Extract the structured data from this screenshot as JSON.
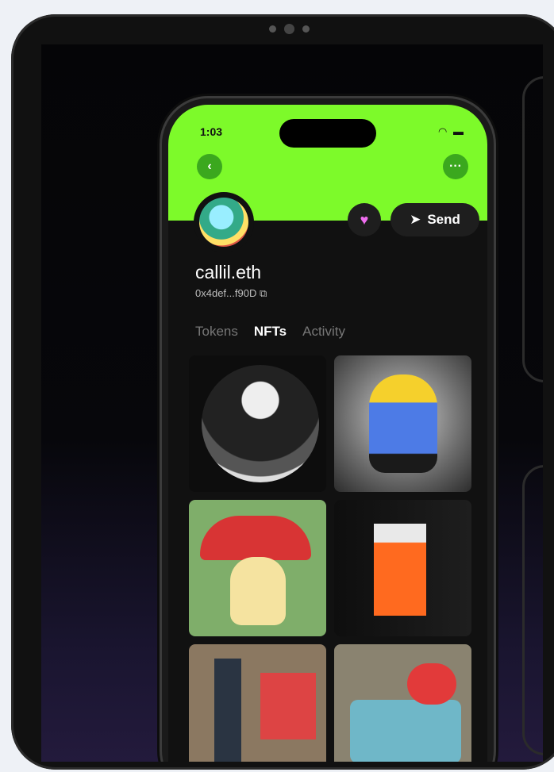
{
  "status_bar": {
    "time": "1:03",
    "indicators": "wifi battery"
  },
  "header": {
    "accent_color": "#7dfa2a",
    "back_icon": "chevron-left-icon",
    "more_icon": "ellipsis-icon"
  },
  "profile": {
    "name": "callil.eth",
    "address": "0x4def...f90D",
    "copy_icon": "copy-icon",
    "favorite_icon": "heart-icon",
    "send_label": "Send",
    "send_icon": "paper-plane-icon"
  },
  "tabs": [
    {
      "label": "Tokens",
      "active": false
    },
    {
      "label": "NFTs",
      "active": true
    },
    {
      "label": "Activity",
      "active": false
    }
  ],
  "nfts": [
    {
      "kind": "sphere-art"
    },
    {
      "kind": "anime-figure"
    },
    {
      "kind": "mushroom-character"
    },
    {
      "kind": "orange-card"
    },
    {
      "kind": "pixel-bottle"
    },
    {
      "kind": "pixel-fish"
    }
  ]
}
